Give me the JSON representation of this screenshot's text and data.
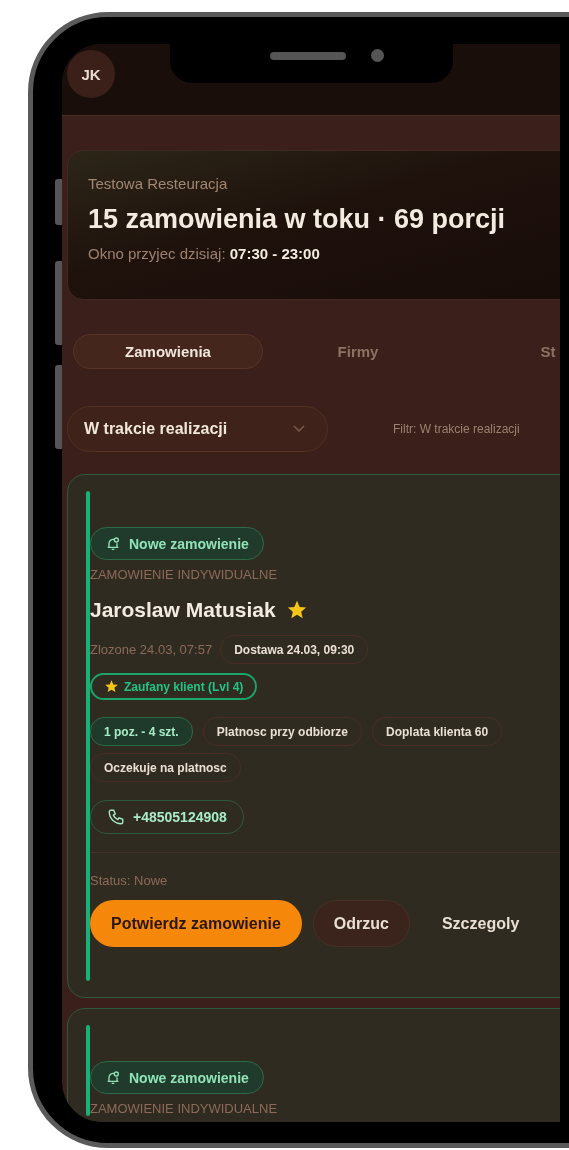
{
  "header": {
    "avatar_initials": "JK"
  },
  "summary": {
    "restaurant": "Testowa Resteuracja",
    "title": "15 zamowienia w toku · 69 porcji",
    "hours": "Okno przyjec dzisiaj: **07:30 - 23:00**"
  },
  "tabs": [
    {
      "label": "Zamowienia",
      "selected": true
    },
    {
      "label": "Firmy",
      "selected": false
    },
    {
      "label": "St",
      "selected": false
    }
  ],
  "status_select": {
    "value": "W trakcie realizacji"
  },
  "filter_note": "Filtr: W trakcie realizacji",
  "orders": [
    {
      "badge": "Nowe zamowienie",
      "type": "ZAMOWIENIE INDYWIDUALNE",
      "customer": "Jaroslaw Matusiak",
      "starred": true,
      "placed": "Zlozone 24.03, 07:57",
      "delivery": "Dostawa 24.03, 09:30",
      "trust": "Zaufany klient (Lvl 4)",
      "chips": [
        {
          "label": "1 poz. - 4 szt.",
          "kind": "count"
        },
        {
          "label": "Platnosc przy odbiorze",
          "kind": "info"
        },
        {
          "label": "Doplata klienta 60",
          "kind": "info"
        },
        {
          "label": "Oczekuje na platnosc",
          "kind": "info"
        }
      ],
      "phone": "+48505124908",
      "status": "Status: Nowe",
      "actions": [
        {
          "label": "Potwierdz zamowienie",
          "kind": "primary"
        },
        {
          "label": "Odrzuc",
          "kind": "secondary"
        },
        {
          "label": "Szczegoly",
          "kind": "text"
        }
      ]
    },
    {
      "badge": "Nowe zamowienie",
      "type": "ZAMOWIENIE INDYWIDUALNE"
    }
  ]
}
